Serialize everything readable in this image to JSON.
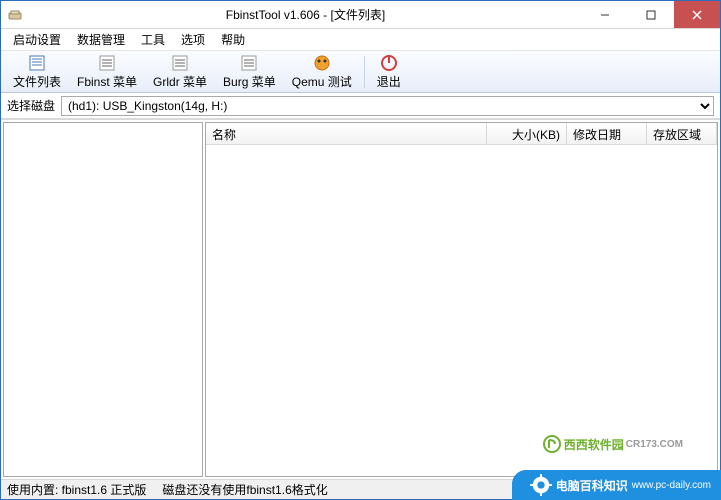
{
  "window": {
    "title": "FbinstTool v1.606 - [文件列表]"
  },
  "menubar": {
    "items": [
      "启动设置",
      "数据管理",
      "工具",
      "选项",
      "帮助"
    ]
  },
  "toolbar": {
    "file_list": "文件列表",
    "fbinst_menu": "Fbinst 菜单",
    "grldr_menu": "Grldr 菜单",
    "burg_menu": "Burg 菜单",
    "qemu_test": "Qemu 测试",
    "exit": "退出"
  },
  "disk": {
    "label": "选择磁盘",
    "selected": "(hd1): USB_Kingston(14g, H:)"
  },
  "columns": {
    "name": "名称",
    "size": "大小(KB)",
    "date": "修改日期",
    "area": "存放区域"
  },
  "status": {
    "left": "使用内置: fbinst1.6 正式版",
    "right": "磁盘还没有使用fbinst1.6格式化"
  },
  "watermark": {
    "brand1": "西西软件园",
    "brand1_sub": "CR173.COM",
    "brand2": "电脑百科知识",
    "brand2_sub": "www.pc-daily.com"
  }
}
